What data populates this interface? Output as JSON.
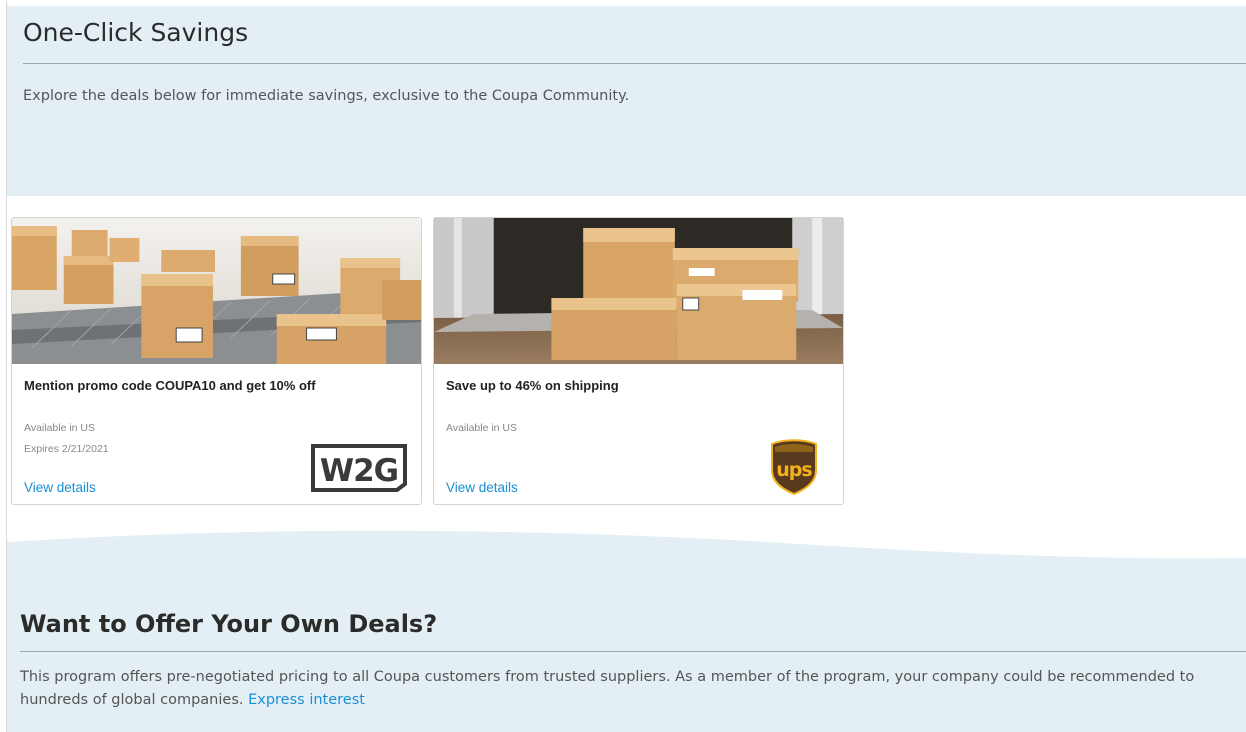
{
  "hero": {
    "title": "One-Click Savings",
    "description": "Explore the deals below for immediate savings, exclusive to the Coupa Community."
  },
  "deals": [
    {
      "title": "Mention promo code COUPA10 and get 10% off",
      "availability": "Available in US",
      "expiry": "Expires 2/21/2021",
      "link": "View details",
      "logo_text": "W2G"
    },
    {
      "title": "Save up to 46% on shipping",
      "availability": "Available in US",
      "link": "View details",
      "logo_text": "ups"
    }
  ],
  "offer": {
    "title": "Want to Offer Your Own Deals?",
    "text": "This program offers pre-negotiated pricing to all Coupa customers from trusted suppliers. As a member of the program, your company could be recommended to hundreds of global companies.",
    "link": "Express interest"
  },
  "colors": {
    "band_bg": "#e3eff4",
    "link": "#1a8fd6",
    "ups_brown": "#5a3a1e",
    "ups_gold": "#f2b21b"
  }
}
